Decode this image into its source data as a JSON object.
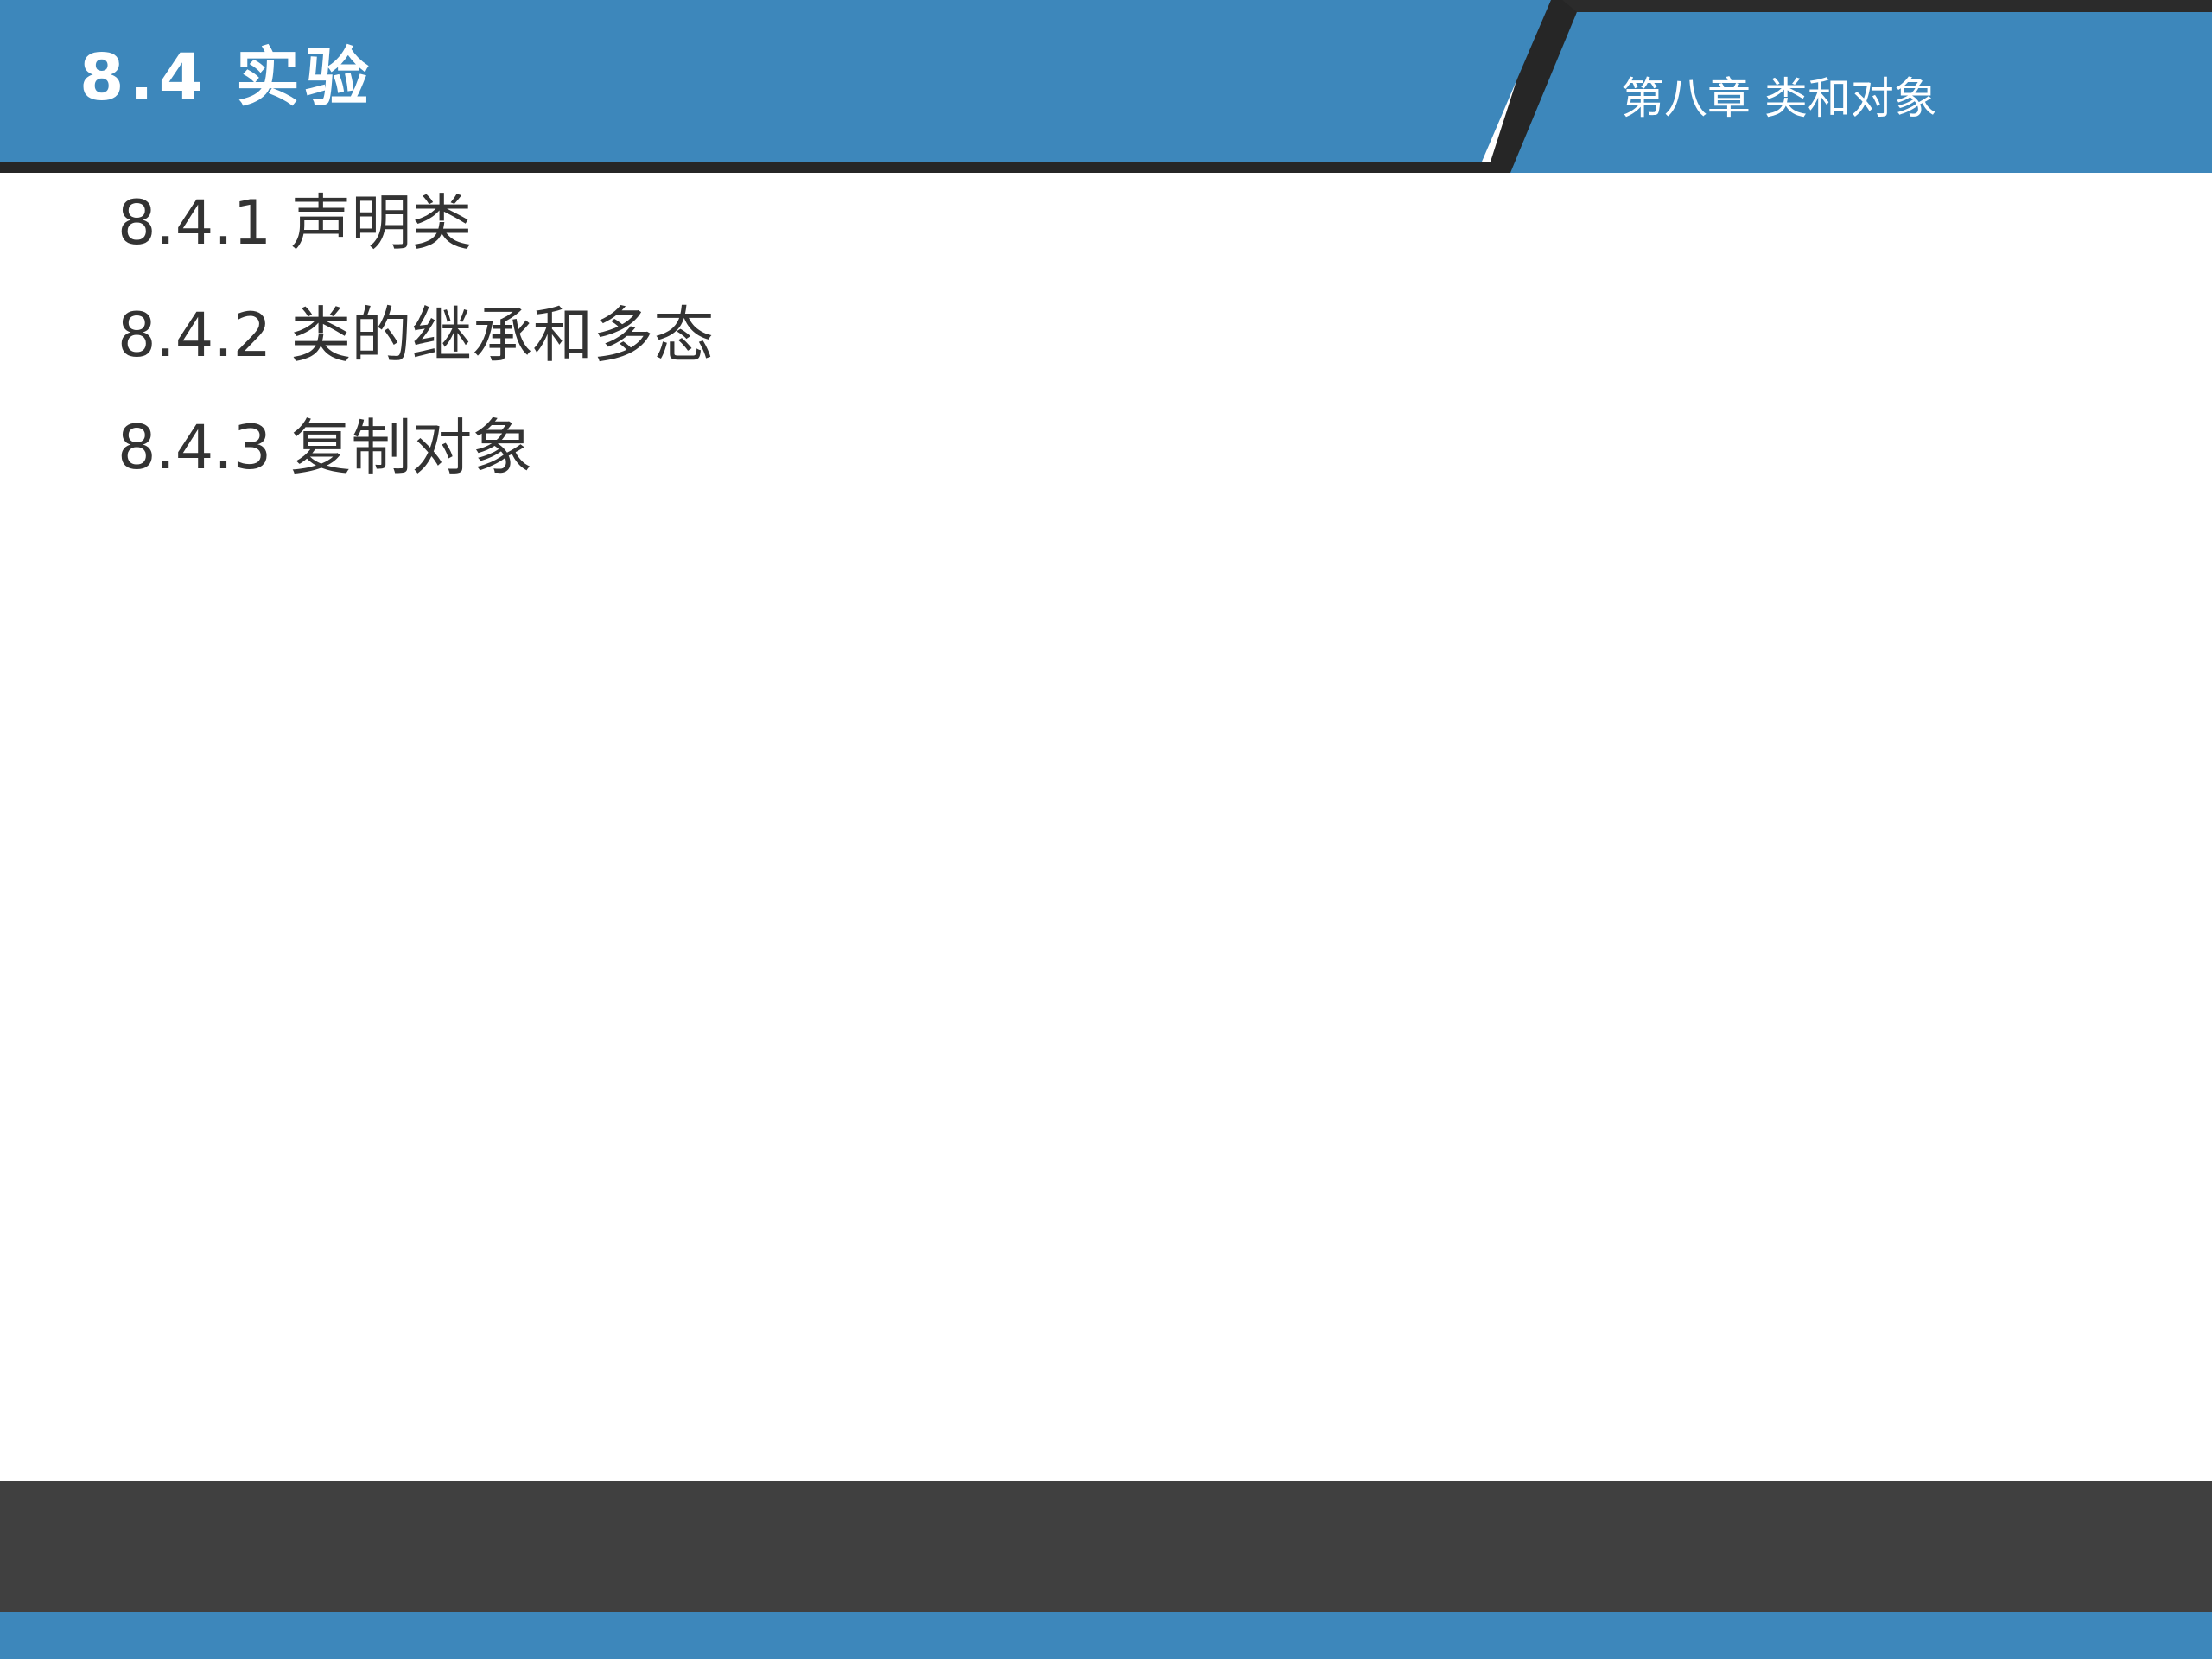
{
  "slide": {
    "title": "8.4 实验",
    "chapter": "第八章 类和对象",
    "outline": [
      "8.4.1 声明类",
      "8.4.2 类的继承和多态",
      "8.4.3 复制对象"
    ]
  },
  "colors": {
    "header_blue": "#3d87bb",
    "accent_dark": "#262626",
    "footer_dark": "#404040",
    "text": "#333333"
  }
}
